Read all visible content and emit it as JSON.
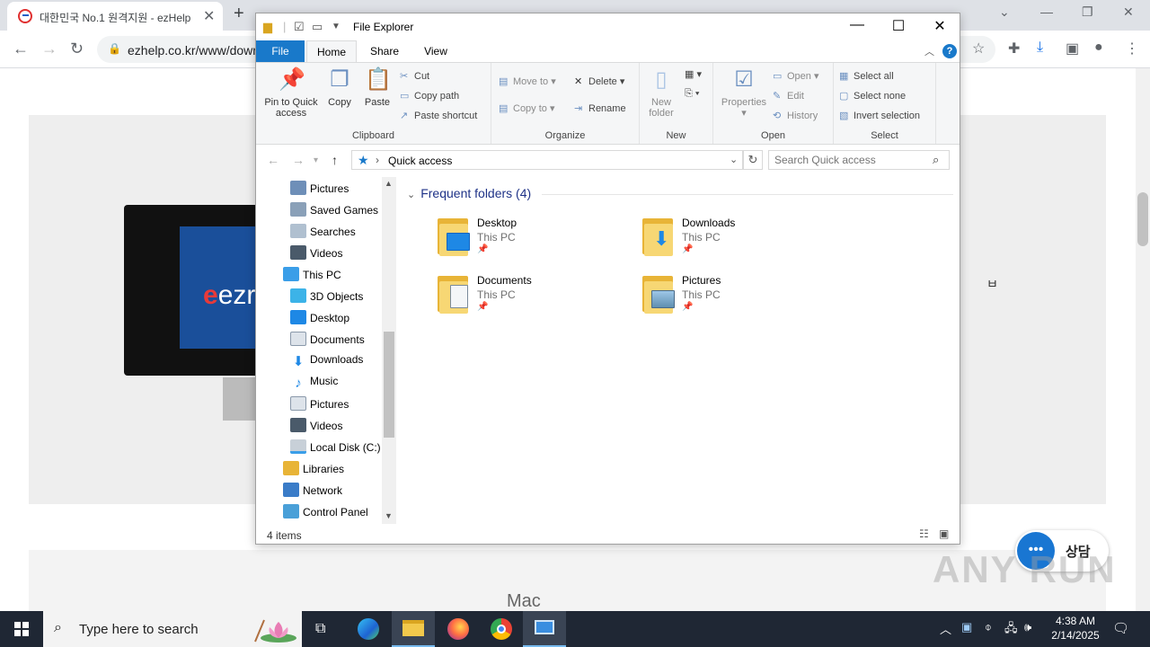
{
  "browser": {
    "tab_title": "대한민국 No.1 원격지원 - ezHelp",
    "tab_close": "✕",
    "new_tab": "+",
    "url": "ezhelp.co.kr/www/down",
    "hero_brand": "ezre",
    "korean_mark": "ㅂ",
    "mac_label": "Mac",
    "chat_label": "상담",
    "watermark": "ANY RUN"
  },
  "explorer": {
    "window_title": "File Explorer",
    "tabs": {
      "file": "File",
      "home": "Home",
      "share": "Share",
      "view": "View"
    },
    "help": "?",
    "ribbon": {
      "clipboard": {
        "label": "Clipboard",
        "pin_line1": "Pin to Quick",
        "pin_line2": "access",
        "copy": "Copy",
        "paste": "Paste",
        "cut": "Cut",
        "copy_path": "Copy path",
        "paste_shortcut": "Paste shortcut"
      },
      "organize": {
        "label": "Organize",
        "move_to": "Move to",
        "copy_to": "Copy to",
        "delete": "Delete",
        "rename": "Rename"
      },
      "new": {
        "label": "New",
        "new_folder_line1": "New",
        "new_folder_line2": "folder"
      },
      "open": {
        "label": "Open",
        "properties": "Properties",
        "open": "Open",
        "edit": "Edit",
        "history": "History"
      },
      "select": {
        "label": "Select",
        "select_all": "Select all",
        "select_none": "Select none",
        "invert": "Invert selection"
      }
    },
    "address": {
      "location": "Quick access",
      "search_placeholder": "Search Quick access"
    },
    "nav_items": [
      {
        "label": "Pictures"
      },
      {
        "label": "Saved Games"
      },
      {
        "label": "Searches"
      },
      {
        "label": "Videos"
      },
      {
        "label": "This PC"
      },
      {
        "label": "3D Objects"
      },
      {
        "label": "Desktop"
      },
      {
        "label": "Documents"
      },
      {
        "label": "Downloads"
      },
      {
        "label": "Music"
      },
      {
        "label": "Pictures"
      },
      {
        "label": "Videos"
      },
      {
        "label": "Local Disk (C:)"
      },
      {
        "label": "Libraries"
      },
      {
        "label": "Network"
      },
      {
        "label": "Control Panel"
      }
    ],
    "section_title": "Frequent folders (4)",
    "folders": [
      {
        "name": "Desktop",
        "location": "This PC"
      },
      {
        "name": "Downloads",
        "location": "This PC"
      },
      {
        "name": "Documents",
        "location": "This PC"
      },
      {
        "name": "Pictures",
        "location": "This PC"
      }
    ],
    "status": "4 items"
  },
  "taskbar": {
    "search_placeholder": "Type here to search",
    "time": "4:38 AM",
    "date": "2/14/2025"
  },
  "colors": {
    "accent": "#1979ca",
    "taskbar": "#1f2734",
    "folder": "#f7d774"
  }
}
